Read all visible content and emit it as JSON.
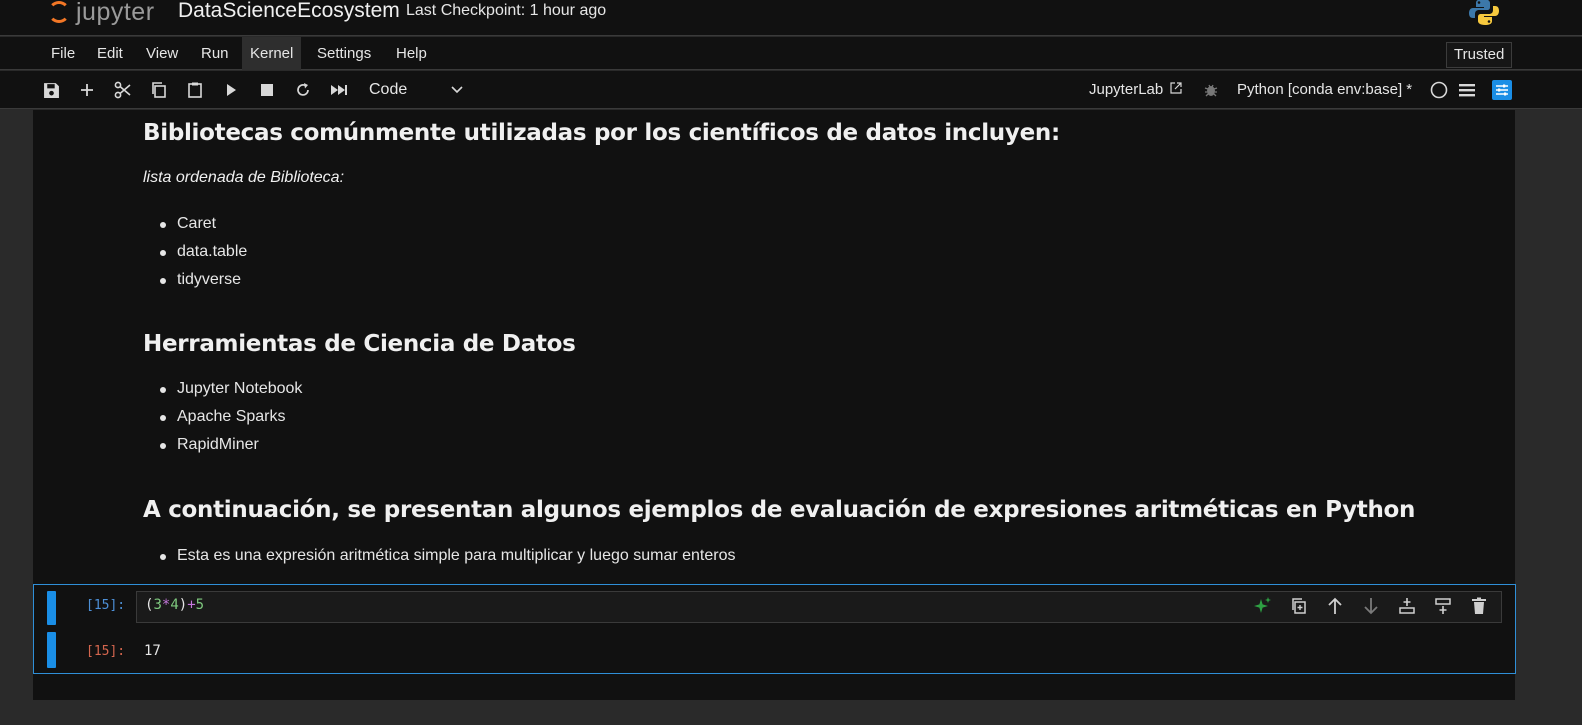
{
  "header": {
    "logo_text": "jupyter",
    "notebook_title": "DataScienceEcosystem",
    "checkpoint": "Last Checkpoint: 1 hour ago"
  },
  "menu": {
    "items": [
      "File",
      "Edit",
      "View",
      "Run",
      "Kernel",
      "Settings",
      "Help"
    ],
    "trusted": "Trusted"
  },
  "toolbar": {
    "cell_type": "Code",
    "jupyterlab_link": "JupyterLab",
    "kernel": "Python [conda env:base] *"
  },
  "notebook": {
    "section1": {
      "heading": "Bibliotecas comúnmente utilizadas por los científicos de datos incluyen:",
      "subtitle": "lista ordenada de Biblioteca:",
      "items": [
        "Caret",
        "data.table",
        "tidyverse"
      ]
    },
    "section2": {
      "heading": "Herramientas de Ciencia de Datos",
      "items": [
        "Jupyter Notebook",
        "Apache Sparks",
        "RapidMiner"
      ]
    },
    "section3": {
      "heading": "A continuación, se presentan algunos ejemplos de evaluación de expresiones aritméticas en Python",
      "items": [
        "Esta es una expresión aritmética simple para multiplicar y luego sumar enteros"
      ]
    },
    "code_cell": {
      "in_prompt": "[15]:",
      "out_prompt": "[15]:",
      "code": {
        "open_paren": "(",
        "a": "3",
        "mul": "*",
        "b": "4",
        "close_paren": ")",
        "add": "+",
        "c": "5"
      },
      "output": "17"
    }
  },
  "colors": {
    "accent": "#1a8ee6",
    "jupyter_orange": "#f37726",
    "ai_sparkle": "#2ea043"
  }
}
